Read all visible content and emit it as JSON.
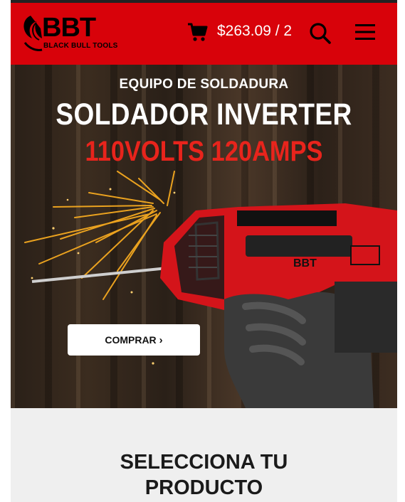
{
  "header": {
    "logo_text": "BBT",
    "logo_subtext": "BLACK BULL TOOLS",
    "cart_total": "$263.09 / 2",
    "icons": [
      "cart-icon",
      "search-icon",
      "menu-icon"
    ]
  },
  "hero": {
    "kicker": "EQUIPO DE SOLDADURA",
    "title": "SOLDADOR INVERTER",
    "spec": "110VOLTS 120AMPS",
    "product_brand_mark": "BBT",
    "cta_label": "COMPRAR",
    "cta_icon": "chevron-right-icon"
  },
  "section": {
    "title_line1": "SELECCIONA TU",
    "title_line2": "PRODUCTO"
  },
  "colors": {
    "brand_red": "#d8020a",
    "spec_red": "#e8241c",
    "section_bg": "#efefef"
  }
}
